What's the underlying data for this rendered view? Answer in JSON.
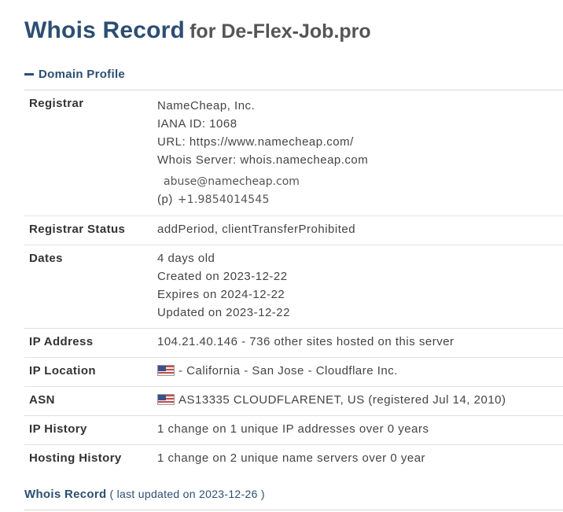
{
  "header": {
    "title": "Whois Record",
    "subtitle": "for De-Flex-Job.pro"
  },
  "section": {
    "label": "Domain Profile",
    "icon": "minus-icon"
  },
  "rows": {
    "registrar": {
      "label": "Registrar",
      "name": "NameCheap, Inc.",
      "iana": "IANA ID: 1068",
      "url": "URL: https://www.namecheap.com/",
      "whois_server": "Whois Server: whois.namecheap.com",
      "email": "abuse@namecheap.com",
      "phone_prefix": "(p)",
      "phone": "+1.9854014545"
    },
    "status": {
      "label": "Registrar Status",
      "value": "addPeriod, clientTransferProhibited"
    },
    "dates": {
      "label": "Dates",
      "age": "4 days old",
      "created": "Created on 2023-12-22",
      "expires": "Expires on 2024-12-22",
      "updated": "Updated on 2023-12-22"
    },
    "ip": {
      "label": "IP Address",
      "value": "104.21.40.146 - 736 other sites hosted on this server"
    },
    "location": {
      "label": "IP Location",
      "flag": "us-flag-icon",
      "value": "- California - San Jose - Cloudflare Inc."
    },
    "asn": {
      "label": "ASN",
      "flag": "us-flag-icon",
      "value": "AS13335 CLOUDFLARENET, US (registered Jul 14, 2010)"
    },
    "ip_history": {
      "label": "IP History",
      "value": "1 change on 1 unique IP addresses over 0 years"
    },
    "hosting_history": {
      "label": "Hosting History",
      "value": "1 change on 2 unique name servers over 0 year"
    }
  },
  "footer": {
    "link": "Whois Record",
    "note": "( last updated on 2023-12-26 )"
  },
  "colors": {
    "accent": "#2c4e72",
    "text": "#333333",
    "divider": "#e2e2e2"
  }
}
